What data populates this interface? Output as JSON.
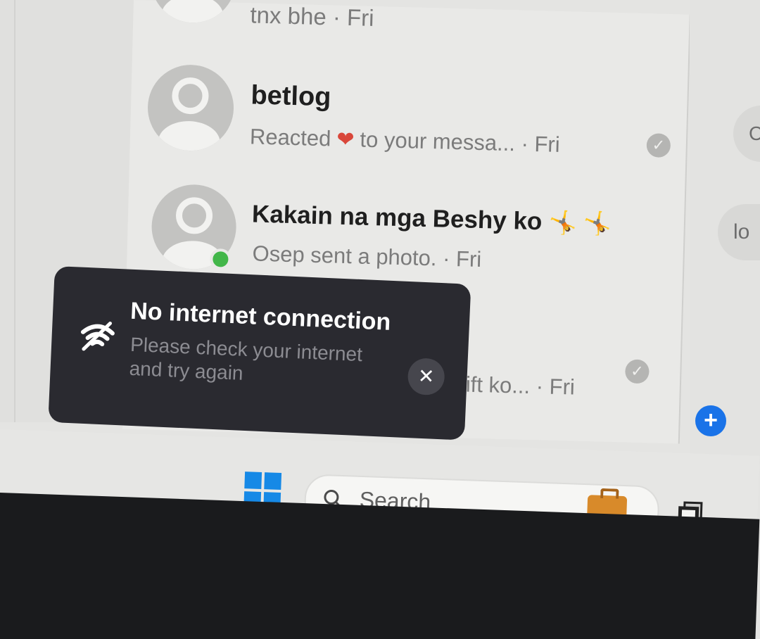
{
  "chats": [
    {
      "name": "",
      "preview": "tnx bhe · Fri",
      "read": false,
      "online": false
    },
    {
      "name": "betlog",
      "preview_before": "Reacted",
      "preview_after": "to your messa... · Fri",
      "reaction_icon": "heart-icon",
      "read": true,
      "online": false
    },
    {
      "name": "Kakain na mga Beshy ko",
      "name_emoji": "🤸 🤸",
      "preview": "Osep sent a photo. · Fri",
      "read": false,
      "online": true
    },
    {
      "name": "",
      "preview": "ift ko... · Fri",
      "read": true,
      "online": false
    }
  ],
  "right_panel": {
    "pill_1": "C",
    "pill_2": "lo"
  },
  "toast": {
    "title": "No internet connection",
    "message": "Please check your internet and try again",
    "icon": "wifi-off-icon",
    "close_icon": "close-icon"
  },
  "fab": {
    "icon": "plus-icon"
  },
  "taskbar": {
    "search_placeholder": "Search",
    "start_icon": "windows-logo-icon",
    "briefcase_icon": "briefcase-icon",
    "task_view_icon": "task-view-icon"
  },
  "colors": {
    "toast_bg": "#2a2a30",
    "online": "#42b649",
    "accent": "#1a73e8",
    "reaction": "#d9473a"
  }
}
